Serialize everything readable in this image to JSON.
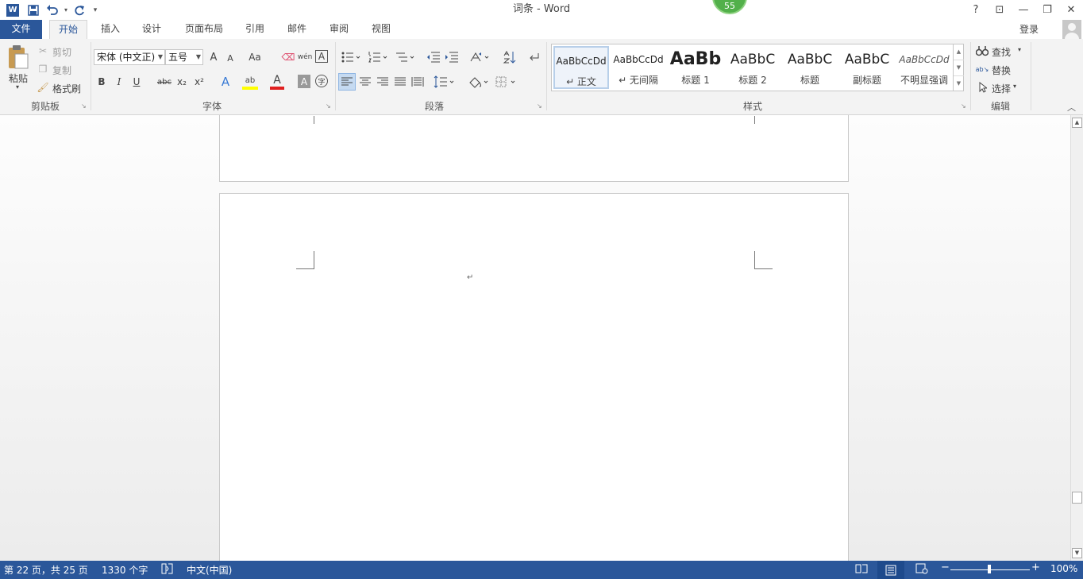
{
  "window": {
    "title": "词条 - Word",
    "badge_count": "55",
    "login": "登录"
  },
  "qat": {
    "word_logo": "W",
    "save_icon": "save-icon",
    "undo_icon": "undo-icon",
    "redo_icon": "redo-icon"
  },
  "win_controls": {
    "help": "?",
    "ribbon_display": "⊡",
    "minimize": "—",
    "restore": "❐",
    "close": "✕"
  },
  "tabs": [
    {
      "label": "文件"
    },
    {
      "label": "开始"
    },
    {
      "label": "插入"
    },
    {
      "label": "设计"
    },
    {
      "label": "页面布局"
    },
    {
      "label": "引用"
    },
    {
      "label": "邮件"
    },
    {
      "label": "审阅"
    },
    {
      "label": "视图"
    }
  ],
  "clipboard": {
    "paste": "粘贴",
    "cut": "剪切",
    "copy": "复制",
    "format_painter": "格式刷",
    "label": "剪贴板"
  },
  "font": {
    "name": "宋体 (中文正)",
    "size": "五号",
    "label": "字体",
    "grow": "A",
    "shrink": "A",
    "case": "Aa",
    "bold": "B",
    "italic": "I",
    "underline": "U",
    "strike": "abc",
    "sub": "x₂",
    "sup": "x²",
    "effects": "A",
    "highlight": "ab",
    "color": "A",
    "shade": "A",
    "enclose": "字",
    "phonetic": "wén",
    "border": "A"
  },
  "paragraph": {
    "label": "段落"
  },
  "styles": {
    "label": "样式",
    "items": [
      {
        "sample": "AaBbCcDd",
        "name": "↵ 正文"
      },
      {
        "sample": "AaBbCcDd",
        "name": "↵ 无间隔"
      },
      {
        "sample": "AaBb",
        "name": "标题 1"
      },
      {
        "sample": "AaBbC",
        "name": "标题 2"
      },
      {
        "sample": "AaBbC",
        "name": "标题"
      },
      {
        "sample": "AaBbC",
        "name": "副标题"
      },
      {
        "sample": "AaBbCcDd",
        "name": "不明显强调"
      }
    ]
  },
  "editing": {
    "find": "查找",
    "replace": "替换",
    "select": "选择",
    "label": "编辑"
  },
  "document": {
    "paragraph_mark": "↵"
  },
  "status": {
    "page": "第 22 页，共 25 页",
    "words": "1330 个字",
    "language": "中文(中国)",
    "zoom": "100%"
  },
  "colors": {
    "accent": "#2b579a",
    "highlight": "#ffff00",
    "font_color": "#e02020"
  }
}
